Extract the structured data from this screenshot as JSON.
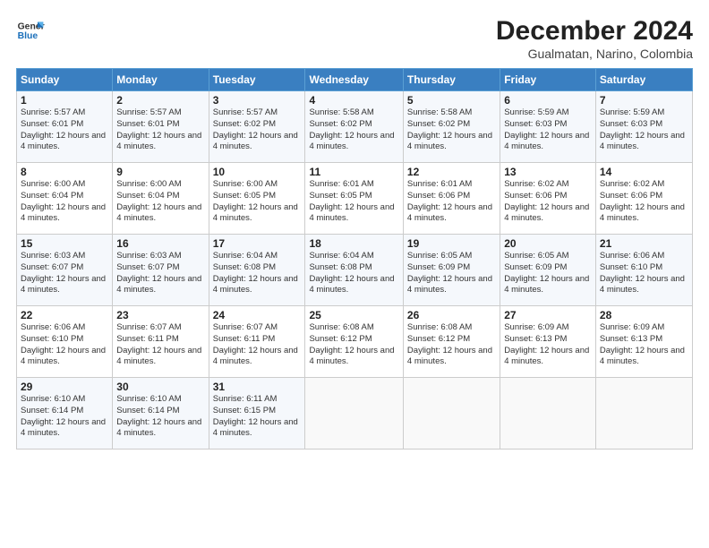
{
  "logo": {
    "line1": "General",
    "line2": "Blue"
  },
  "title": "December 2024",
  "subtitle": "Gualmatan, Narino, Colombia",
  "days_of_week": [
    "Sunday",
    "Monday",
    "Tuesday",
    "Wednesday",
    "Thursday",
    "Friday",
    "Saturday"
  ],
  "weeks": [
    [
      {
        "day": "1",
        "info": "Sunrise: 5:57 AM\nSunset: 6:01 PM\nDaylight: 12 hours and 4 minutes."
      },
      {
        "day": "2",
        "info": "Sunrise: 5:57 AM\nSunset: 6:01 PM\nDaylight: 12 hours and 4 minutes."
      },
      {
        "day": "3",
        "info": "Sunrise: 5:57 AM\nSunset: 6:02 PM\nDaylight: 12 hours and 4 minutes."
      },
      {
        "day": "4",
        "info": "Sunrise: 5:58 AM\nSunset: 6:02 PM\nDaylight: 12 hours and 4 minutes."
      },
      {
        "day": "5",
        "info": "Sunrise: 5:58 AM\nSunset: 6:02 PM\nDaylight: 12 hours and 4 minutes."
      },
      {
        "day": "6",
        "info": "Sunrise: 5:59 AM\nSunset: 6:03 PM\nDaylight: 12 hours and 4 minutes."
      },
      {
        "day": "7",
        "info": "Sunrise: 5:59 AM\nSunset: 6:03 PM\nDaylight: 12 hours and 4 minutes."
      }
    ],
    [
      {
        "day": "8",
        "info": "Sunrise: 6:00 AM\nSunset: 6:04 PM\nDaylight: 12 hours and 4 minutes."
      },
      {
        "day": "9",
        "info": "Sunrise: 6:00 AM\nSunset: 6:04 PM\nDaylight: 12 hours and 4 minutes."
      },
      {
        "day": "10",
        "info": "Sunrise: 6:00 AM\nSunset: 6:05 PM\nDaylight: 12 hours and 4 minutes."
      },
      {
        "day": "11",
        "info": "Sunrise: 6:01 AM\nSunset: 6:05 PM\nDaylight: 12 hours and 4 minutes."
      },
      {
        "day": "12",
        "info": "Sunrise: 6:01 AM\nSunset: 6:06 PM\nDaylight: 12 hours and 4 minutes."
      },
      {
        "day": "13",
        "info": "Sunrise: 6:02 AM\nSunset: 6:06 PM\nDaylight: 12 hours and 4 minutes."
      },
      {
        "day": "14",
        "info": "Sunrise: 6:02 AM\nSunset: 6:06 PM\nDaylight: 12 hours and 4 minutes."
      }
    ],
    [
      {
        "day": "15",
        "info": "Sunrise: 6:03 AM\nSunset: 6:07 PM\nDaylight: 12 hours and 4 minutes."
      },
      {
        "day": "16",
        "info": "Sunrise: 6:03 AM\nSunset: 6:07 PM\nDaylight: 12 hours and 4 minutes."
      },
      {
        "day": "17",
        "info": "Sunrise: 6:04 AM\nSunset: 6:08 PM\nDaylight: 12 hours and 4 minutes."
      },
      {
        "day": "18",
        "info": "Sunrise: 6:04 AM\nSunset: 6:08 PM\nDaylight: 12 hours and 4 minutes."
      },
      {
        "day": "19",
        "info": "Sunrise: 6:05 AM\nSunset: 6:09 PM\nDaylight: 12 hours and 4 minutes."
      },
      {
        "day": "20",
        "info": "Sunrise: 6:05 AM\nSunset: 6:09 PM\nDaylight: 12 hours and 4 minutes."
      },
      {
        "day": "21",
        "info": "Sunrise: 6:06 AM\nSunset: 6:10 PM\nDaylight: 12 hours and 4 minutes."
      }
    ],
    [
      {
        "day": "22",
        "info": "Sunrise: 6:06 AM\nSunset: 6:10 PM\nDaylight: 12 hours and 4 minutes."
      },
      {
        "day": "23",
        "info": "Sunrise: 6:07 AM\nSunset: 6:11 PM\nDaylight: 12 hours and 4 minutes."
      },
      {
        "day": "24",
        "info": "Sunrise: 6:07 AM\nSunset: 6:11 PM\nDaylight: 12 hours and 4 minutes."
      },
      {
        "day": "25",
        "info": "Sunrise: 6:08 AM\nSunset: 6:12 PM\nDaylight: 12 hours and 4 minutes."
      },
      {
        "day": "26",
        "info": "Sunrise: 6:08 AM\nSunset: 6:12 PM\nDaylight: 12 hours and 4 minutes."
      },
      {
        "day": "27",
        "info": "Sunrise: 6:09 AM\nSunset: 6:13 PM\nDaylight: 12 hours and 4 minutes."
      },
      {
        "day": "28",
        "info": "Sunrise: 6:09 AM\nSunset: 6:13 PM\nDaylight: 12 hours and 4 minutes."
      }
    ],
    [
      {
        "day": "29",
        "info": "Sunrise: 6:10 AM\nSunset: 6:14 PM\nDaylight: 12 hours and 4 minutes."
      },
      {
        "day": "30",
        "info": "Sunrise: 6:10 AM\nSunset: 6:14 PM\nDaylight: 12 hours and 4 minutes."
      },
      {
        "day": "31",
        "info": "Sunrise: 6:11 AM\nSunset: 6:15 PM\nDaylight: 12 hours and 4 minutes."
      },
      {
        "day": "",
        "info": ""
      },
      {
        "day": "",
        "info": ""
      },
      {
        "day": "",
        "info": ""
      },
      {
        "day": "",
        "info": ""
      }
    ]
  ]
}
